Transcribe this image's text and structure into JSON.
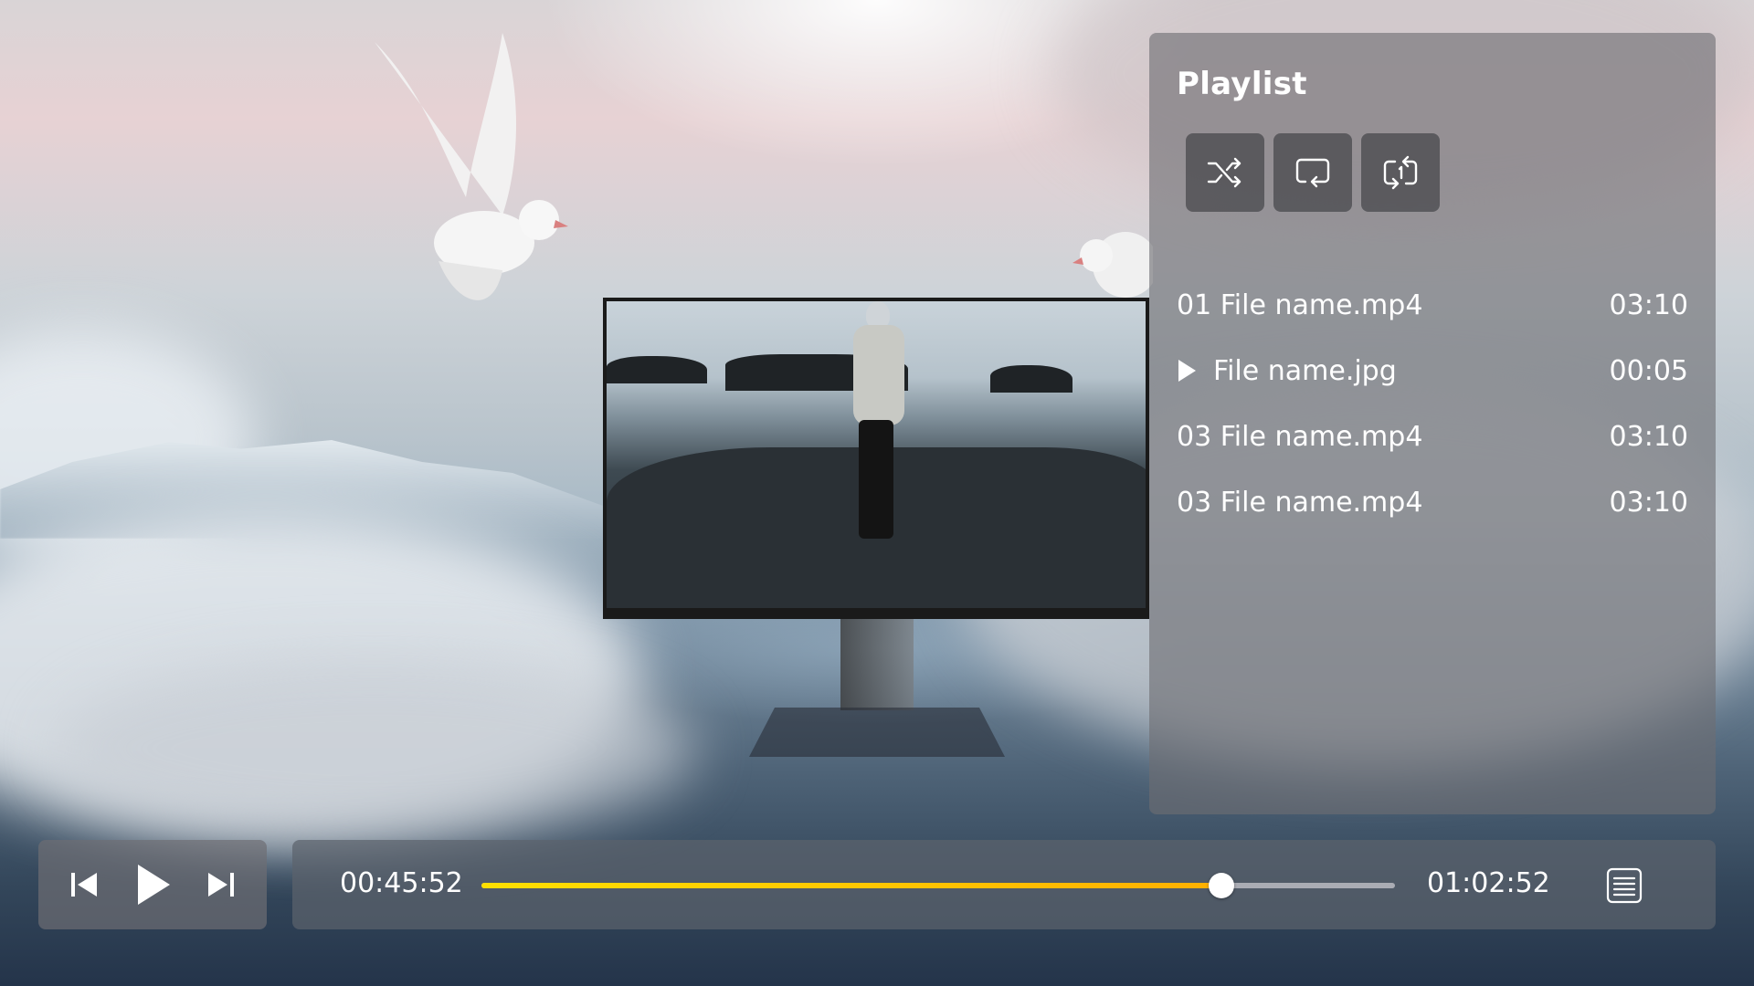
{
  "playlist": {
    "title": "Playlist",
    "mode_buttons": [
      {
        "name": "shuffle",
        "icon": "shuffle-icon"
      },
      {
        "name": "repeat",
        "icon": "repeat-icon"
      },
      {
        "name": "repeat-one",
        "icon": "repeat-one-icon"
      }
    ],
    "tracks": [
      {
        "name": "01 File name.mp4",
        "duration": "03:10",
        "playing": false
      },
      {
        "name": "File name.jpg",
        "duration": "00:05",
        "playing": true
      },
      {
        "name": "03 File name.mp4",
        "duration": "03:10",
        "playing": false
      },
      {
        "name": "03 File name.mp4",
        "duration": "03:10",
        "playing": false
      }
    ]
  },
  "transport": {
    "previous_icon": "skip-previous-icon",
    "play_icon": "play-icon",
    "next_icon": "skip-next-icon"
  },
  "progress": {
    "current_time": "00:45:52",
    "total_time": "01:02:52",
    "fraction": 0.81
  },
  "playlist_toggle_icon": "playlist-icon",
  "colors": {
    "progress_start": "#ffe000",
    "progress_end": "#ffb000",
    "panel": "#6e6e72"
  }
}
